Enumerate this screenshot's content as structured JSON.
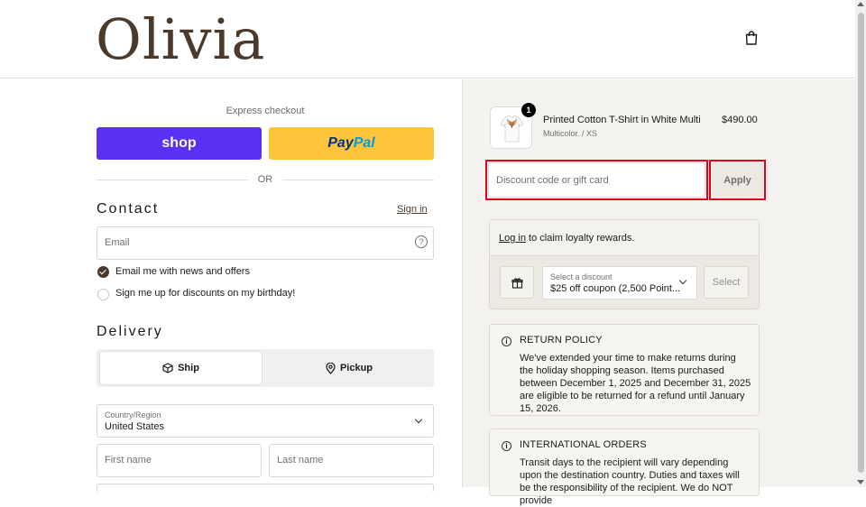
{
  "header": {
    "logo": "Olivia",
    "cart_icon": "shopping-bag-icon"
  },
  "express": {
    "label": "Express checkout",
    "shop_label": "shop",
    "paypal_pay": "Pay",
    "paypal_pal": "Pal",
    "or_label": "OR"
  },
  "contact": {
    "title": "Contact",
    "sign_in": "Sign in",
    "email_placeholder": "Email",
    "help_icon": "?",
    "news_label": "Email me with news and offers",
    "news_checked": true,
    "birthday_label": "Sign me up for discounts on my birthday!",
    "birthday_checked": false
  },
  "delivery": {
    "title": "Delivery",
    "tabs": [
      {
        "label": "Ship",
        "icon": "package-icon",
        "selected": true
      },
      {
        "label": "Pickup",
        "icon": "map-pin-icon",
        "selected": false
      }
    ],
    "country_label": "Country/Region",
    "country_value": "United States",
    "first_name_placeholder": "First name",
    "last_name_placeholder": "Last name"
  },
  "order": {
    "item": {
      "name": "Printed Cotton T-Shirt in White Multi",
      "variant": "Multicolor. / XS",
      "price": "$490.00",
      "quantity": "1"
    },
    "discount_placeholder": "Discount code or gift card",
    "apply_label": "Apply"
  },
  "loyalty": {
    "link": "Log in",
    "text": " to claim loyalty rewards.",
    "select_label": "Select a discount",
    "select_value": "$25 off coupon (2,500 Point...",
    "select_button": "Select"
  },
  "policies": [
    {
      "title": "RETURN POLICY",
      "body": "We've extended your time to make returns during the holiday shopping season. Items purchased between December 1, 2025 and December 31, 2025 are eligible to be returned for a refund until January 15, 2026."
    },
    {
      "title": "INTERNATIONAL ORDERS",
      "body": "Transit days to the recipient will vary depending upon the destination country. Duties and taxes will be the responsibility of the recipient. We do NOT provide"
    }
  ],
  "colors": {
    "shop_pay": "#5a31f4",
    "paypal": "#ffc439",
    "brand": "#4b3a2b",
    "highlight": "#e3001b",
    "summary_bg": "#f4f2ee"
  }
}
